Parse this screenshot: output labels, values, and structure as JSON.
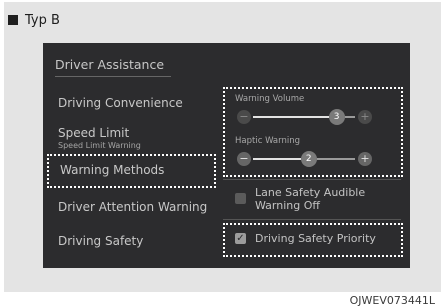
{
  "header": {
    "label": "Typ B"
  },
  "screen": {
    "title": "Driver Assistance",
    "menu": [
      {
        "label": "Driving Convenience",
        "sub": ""
      },
      {
        "label": "Speed Limit",
        "sub": "Speed Limit Warning"
      },
      {
        "label": "Warning Methods",
        "sub": ""
      },
      {
        "label": "Driver Attention Warning",
        "sub": ""
      },
      {
        "label": "Driving Safety",
        "sub": ""
      }
    ],
    "warning_volume": {
      "label": "Warning Volume",
      "value": "3",
      "level": 3,
      "max": 3,
      "minus": "−",
      "plus": "+"
    },
    "haptic_warning": {
      "label": "Haptic Warning",
      "value": "2",
      "level": 2,
      "max": 3,
      "minus": "−",
      "plus": "+"
    },
    "options": [
      {
        "label": "Lane Safety Audible Warning Off",
        "checked": false
      },
      {
        "label": "Driving Safety Priority",
        "checked": true,
        "mark": "✓"
      }
    ]
  },
  "figure_code": "OJWEV073441L"
}
